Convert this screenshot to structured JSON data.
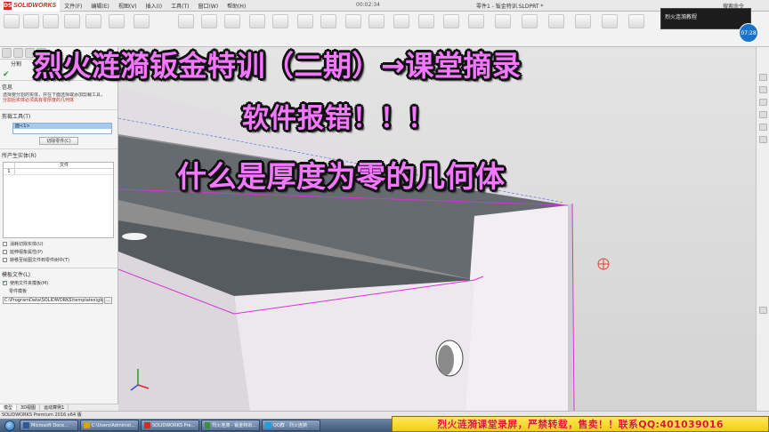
{
  "app": {
    "logo_text": "SOLIDWORKS",
    "menu": [
      "文件(F)",
      "编辑(E)",
      "视图(V)",
      "插入(I)",
      "工具(T)",
      "窗口(W)",
      "帮助(H)"
    ],
    "recording_time": "00:02:34",
    "document_title": "零件1 - 钣金特训.SLDPRT *",
    "title_right": "搜索命令"
  },
  "popup": {
    "label": "烈火连漪教程",
    "timer": "07:28"
  },
  "property_manager": {
    "title": "分割",
    "section_message": "信息",
    "message_line1": "选择要分割的实体，并在下面选择或添加剪裁工具，",
    "message_line2": "分割后实体必须具有零厚度的几何体",
    "section_tools": "剪裁工具(T)",
    "selected_item": "面<1>",
    "cut_button": "切除零件(C)",
    "section_bodies": "所产生实体(R)",
    "table_head_num": "",
    "table_head_file": "文件",
    "table_row1_num": "1",
    "checks": [
      {
        "label": "消耗切除实体(U)",
        "checked": false
      },
      {
        "label": "延伸视象属性(P)",
        "checked": false
      },
      {
        "label": "转移至绘图文件到零件树中(T)",
        "checked": false
      }
    ],
    "section_template": "模板文件(L)",
    "template_check": "使用文件夹模板(M)",
    "template_sub": "零件模板",
    "template_path": "C:\\ProgramData\\SOLIDWORKS\\templates\\gb_part.prtdot",
    "browse_label": "...",
    "bottom_tabs": [
      "模型",
      "3D视图",
      "运动算例1"
    ]
  },
  "statusbar": {
    "text": "SOLIDWORKS Premium 2016 x64 版"
  },
  "taskbar": {
    "tasks": [
      {
        "label": "Microsoft Doce...",
        "color": "#2b5797"
      },
      {
        "label": "C:\\Users\\Administ...",
        "color": "#d9a400"
      },
      {
        "label": "SOLIDWORKS Pre...",
        "color": "#d52b1e"
      },
      {
        "label": "烈火连漪 - 钣金特训...",
        "color": "#3a8e3a"
      },
      {
        "label": "QQ群 - 烈火连漪",
        "color": "#1aa1e6"
      }
    ]
  },
  "overlays": {
    "title1": "烈火涟漪钣金特训（二期）→课堂摘录",
    "title2": "软件报错！！！",
    "title3": "什么是厚度为零的几何体"
  },
  "banner": {
    "text": "烈火涟漪课堂录屏，严禁转载，售卖！！联系QQ:401039016"
  },
  "colors": {
    "overlay_text": "#f478ff",
    "banner_bg": "#f1cf12",
    "banner_text": "#e0172c",
    "highlight_edge": "#d633d6"
  }
}
